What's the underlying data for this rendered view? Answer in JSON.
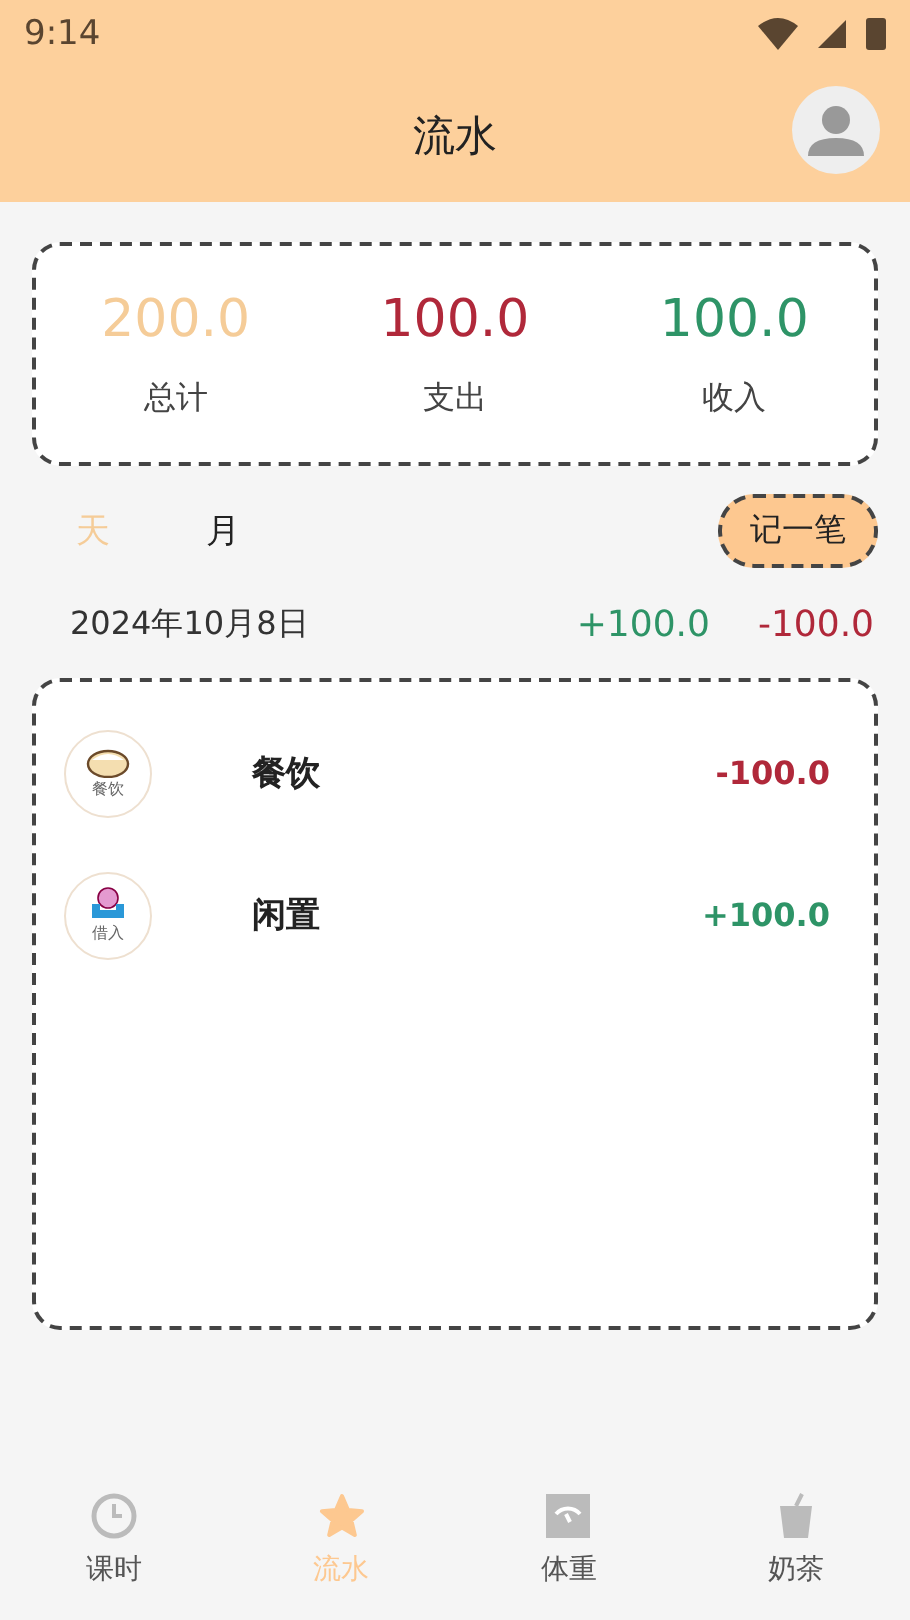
{
  "status_bar": {
    "time": "9:14"
  },
  "header": {
    "title": "流水"
  },
  "summary": [
    {
      "kind": "total",
      "value": "200.0",
      "label": "总计"
    },
    {
      "kind": "expense",
      "value": "100.0",
      "label": "支出"
    },
    {
      "kind": "income",
      "value": "100.0",
      "label": "收入"
    }
  ],
  "period_tabs": [
    {
      "label": "天",
      "selected": true
    },
    {
      "label": "月",
      "selected": false
    }
  ],
  "add_button": "记一笔",
  "day": {
    "date": "2024年10月8日",
    "income": "+100.0",
    "expense": "-100.0"
  },
  "entries": [
    {
      "kind": "expense",
      "icon_label": "餐饮",
      "name": "餐饮",
      "amount": "-100.0"
    },
    {
      "kind": "income",
      "icon_label": "借入",
      "name": "闲置",
      "amount": "+100.0"
    }
  ],
  "nav": [
    {
      "kind": "clock",
      "label": "课时",
      "selected": false
    },
    {
      "kind": "star",
      "label": "流水",
      "selected": true
    },
    {
      "kind": "scale",
      "label": "体重",
      "selected": false
    },
    {
      "kind": "cup",
      "label": "奶茶",
      "selected": false
    }
  ]
}
